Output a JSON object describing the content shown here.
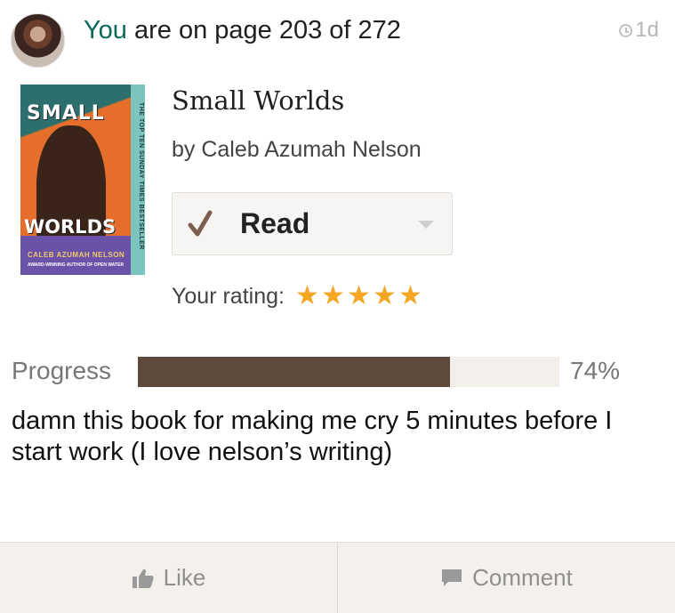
{
  "header": {
    "you_label": "You",
    "status_text": " are on page 203 of 272",
    "timestamp": "1d"
  },
  "book": {
    "title": "Small Worlds",
    "byline": "by Caleb Azumah Nelson",
    "cover": {
      "title_line1": "SMALL",
      "title_line2": "WORLDS",
      "author": "CALEB AZUMAH NELSON",
      "author_note": "AWARD-WINNING AUTHOR OF OPEN WATER",
      "spine_text": "THE TOP TEN SUNDAY TIMES BESTSELLER"
    }
  },
  "shelf": {
    "label": "Read",
    "check_color": "#7b5e4d"
  },
  "rating": {
    "label": "Your rating:",
    "stars": 5,
    "star_char": "★",
    "color": "#f5a623"
  },
  "progress": {
    "label": "Progress",
    "percent_text": "74%",
    "fraction": 0.74,
    "fill_color": "#5e4a3d"
  },
  "review": {
    "text": "damn this book for making me cry 5 minutes before I start work (I love nelson’s writing)"
  },
  "actions": {
    "like_label": "Like",
    "comment_label": "Comment"
  }
}
